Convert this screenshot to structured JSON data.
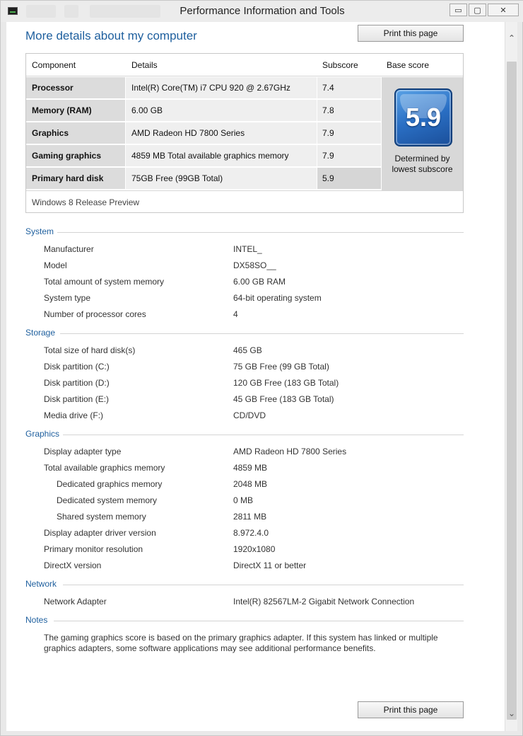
{
  "window": {
    "title": "Performance Information and Tools",
    "minimize_label": "▭",
    "maximize_label": "▢",
    "close_label": "✕"
  },
  "heading": "More details about my computer",
  "print_button_label": "Print this page",
  "score_table": {
    "headers": [
      "Component",
      "Details",
      "Subscore",
      "Base score"
    ],
    "rows": [
      {
        "component": "Processor",
        "details": "Intel(R) Core(TM) i7 CPU 920 @ 2.67GHz",
        "subscore": "7.4"
      },
      {
        "component": "Memory (RAM)",
        "details": "6.00 GB",
        "subscore": "7.8"
      },
      {
        "component": "Graphics",
        "details": "AMD Radeon HD 7800 Series",
        "subscore": "7.9"
      },
      {
        "component": "Gaming graphics",
        "details": "4859 MB Total available graphics memory",
        "subscore": "7.9"
      },
      {
        "component": "Primary hard disk",
        "details": "75GB Free (99GB Total)",
        "subscore": "5.9"
      }
    ],
    "base_score": "5.9",
    "base_score_note_line1": "Determined by",
    "base_score_note_line2": "lowest subscore",
    "edition": "Windows 8 Release Preview"
  },
  "sections": {
    "system": {
      "title": "System",
      "items": [
        {
          "label": "Manufacturer",
          "value": "INTEL_"
        },
        {
          "label": "Model",
          "value": "DX58SO__"
        },
        {
          "label": "Total amount of system memory",
          "value": "6.00 GB RAM"
        },
        {
          "label": "System type",
          "value": "64-bit operating system"
        },
        {
          "label": "Number of processor cores",
          "value": "4"
        }
      ]
    },
    "storage": {
      "title": "Storage",
      "items": [
        {
          "label": "Total size of hard disk(s)",
          "value": "465 GB"
        },
        {
          "label": "Disk partition (C:)",
          "value": "75 GB Free (99 GB Total)"
        },
        {
          "label": "Disk partition (D:)",
          "value": "120 GB Free (183 GB Total)"
        },
        {
          "label": "Disk partition (E:)",
          "value": "45 GB Free (183 GB Total)"
        },
        {
          "label": "Media drive (F:)",
          "value": "CD/DVD"
        }
      ]
    },
    "graphics": {
      "title": "Graphics",
      "items": [
        {
          "label": "Display adapter type",
          "value": "AMD Radeon HD 7800 Series"
        },
        {
          "label": "Total available graphics memory",
          "value": "4859 MB"
        },
        {
          "label": "Dedicated graphics memory",
          "value": "2048 MB"
        },
        {
          "label": "Dedicated system memory",
          "value": "0 MB"
        },
        {
          "label": "Shared system memory",
          "value": "2811 MB"
        },
        {
          "label": "Display adapter driver version",
          "value": "8.972.4.0"
        },
        {
          "label": "Primary monitor resolution",
          "value": "1920x1080"
        },
        {
          "label": "DirectX version",
          "value": "DirectX 11 or better"
        }
      ]
    },
    "network": {
      "title": "Network",
      "items": [
        {
          "label": "Network Adapter",
          "value": "Intel(R) 82567LM-2 Gigabit Network Connection"
        }
      ]
    },
    "notes": {
      "title": "Notes",
      "text": "The gaming graphics score is based on the primary graphics adapter. If this system has linked or multiple graphics adapters, some software applications may see additional performance benefits."
    }
  }
}
